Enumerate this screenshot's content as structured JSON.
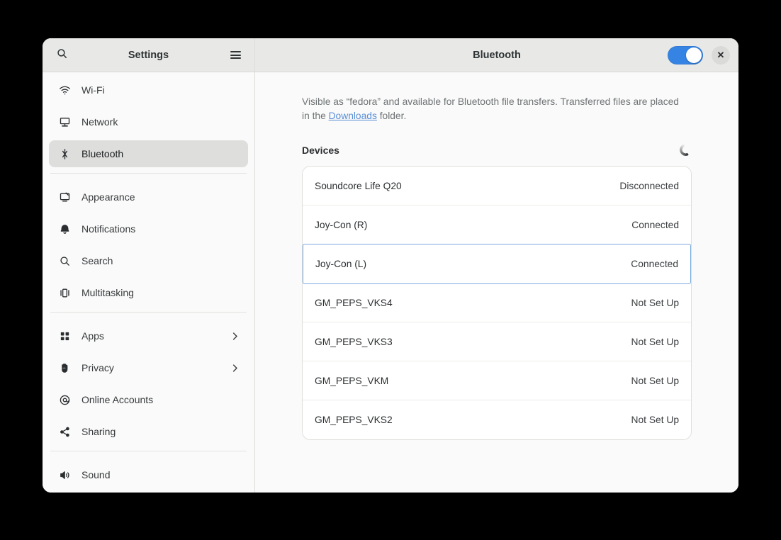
{
  "window": {
    "accent_color": "#3584e4",
    "background": "#fafafa",
    "header_background": "#e8e8e6"
  },
  "sidebar": {
    "title": "Settings",
    "search_icon": "search-icon",
    "menu_icon": "hamburger-menu-icon",
    "items": [
      {
        "label": "Wi-Fi",
        "icon": "wifi-icon",
        "selected": false,
        "chevron": false
      },
      {
        "label": "Network",
        "icon": "network-icon",
        "selected": false,
        "chevron": false
      },
      {
        "label": "Bluetooth",
        "icon": "bluetooth-icon",
        "selected": true,
        "chevron": false
      },
      {
        "divider": true
      },
      {
        "label": "Appearance",
        "icon": "appearance-icon",
        "selected": false,
        "chevron": false
      },
      {
        "label": "Notifications",
        "icon": "bell-icon",
        "selected": false,
        "chevron": false
      },
      {
        "label": "Search",
        "icon": "search-icon",
        "selected": false,
        "chevron": false
      },
      {
        "label": "Multitasking",
        "icon": "multitasking-icon",
        "selected": false,
        "chevron": false
      },
      {
        "divider": true
      },
      {
        "label": "Apps",
        "icon": "apps-grid-icon",
        "selected": false,
        "chevron": true
      },
      {
        "label": "Privacy",
        "icon": "hand-icon",
        "selected": false,
        "chevron": true
      },
      {
        "label": "Online Accounts",
        "icon": "at-sign-icon",
        "selected": false,
        "chevron": false
      },
      {
        "label": "Sharing",
        "icon": "share-icon",
        "selected": false,
        "chevron": false
      },
      {
        "divider": true
      },
      {
        "label": "Sound",
        "icon": "speaker-icon",
        "selected": false,
        "chevron": false
      }
    ]
  },
  "main": {
    "title": "Bluetooth",
    "bluetooth_enabled": true,
    "toggle_name": "bluetooth-power-toggle",
    "close_label": "✕",
    "description": {
      "before_link": "Visible as “fedora” and available for Bluetooth file transfers. Transferred files are placed in the ",
      "link_text": "Downloads",
      "after_link": " folder."
    },
    "devices_section": {
      "title": "Devices",
      "scanning": true,
      "spinner_name": "scanning-spinner"
    },
    "devices": [
      {
        "name": "Soundcore Life Q20",
        "status": "Disconnected",
        "focused": false
      },
      {
        "name": "Joy-Con (R)",
        "status": "Connected",
        "focused": false
      },
      {
        "name": "Joy-Con (L)",
        "status": "Connected",
        "focused": true
      },
      {
        "name": "GM_PEPS_VKS4",
        "status": "Not Set Up",
        "focused": false
      },
      {
        "name": "GM_PEPS_VKS3",
        "status": "Not Set Up",
        "focused": false
      },
      {
        "name": "GM_PEPS_VKM",
        "status": "Not Set Up",
        "focused": false
      },
      {
        "name": "GM_PEPS_VKS2",
        "status": "Not Set Up",
        "focused": false
      }
    ]
  }
}
